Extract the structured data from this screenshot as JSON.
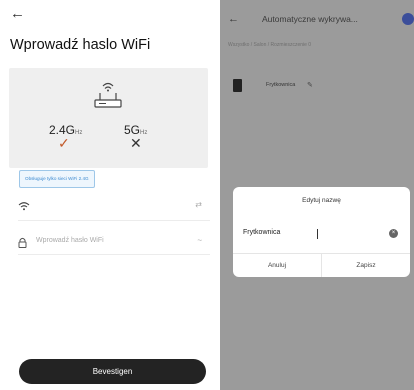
{
  "left_screen": {
    "back_glyph": "←",
    "title": "Wprowadź haslo WiFi",
    "bands": {
      "band_24": "2.4G",
      "band_24_unit": "Hz",
      "band_5": "5G",
      "band_5_unit": "Hz",
      "check_glyph": "✓",
      "cross_glyph": "✕"
    },
    "tooltip": "Obsługuje tylko sieci WiFi 2.4G",
    "password_placeholder": "Wprowadź hasło WiFi",
    "swap_glyph": "⇄",
    "eye_glyph": "~",
    "confirm_label": "Bevestigen"
  },
  "right_screen": {
    "back_glyph": "←",
    "title": "Automatyczne wykrywa...",
    "breadcrumb": "Wszystko / Salon / Rozmieszczenie 0",
    "device_name": "Frytkownica",
    "edit_glyph": "✎",
    "dialog": {
      "title": "Edytuj nazwę",
      "input_value": "Frytkownica",
      "clear_glyph": "×",
      "cancel_label": "Anuluj",
      "save_label": "Zapisz"
    }
  },
  "colors": {
    "accent_check": "#c25a2a",
    "overlay": "#9b9b9b",
    "button_dark": "#232323",
    "tooltip_blue": "#3d8ad0"
  }
}
